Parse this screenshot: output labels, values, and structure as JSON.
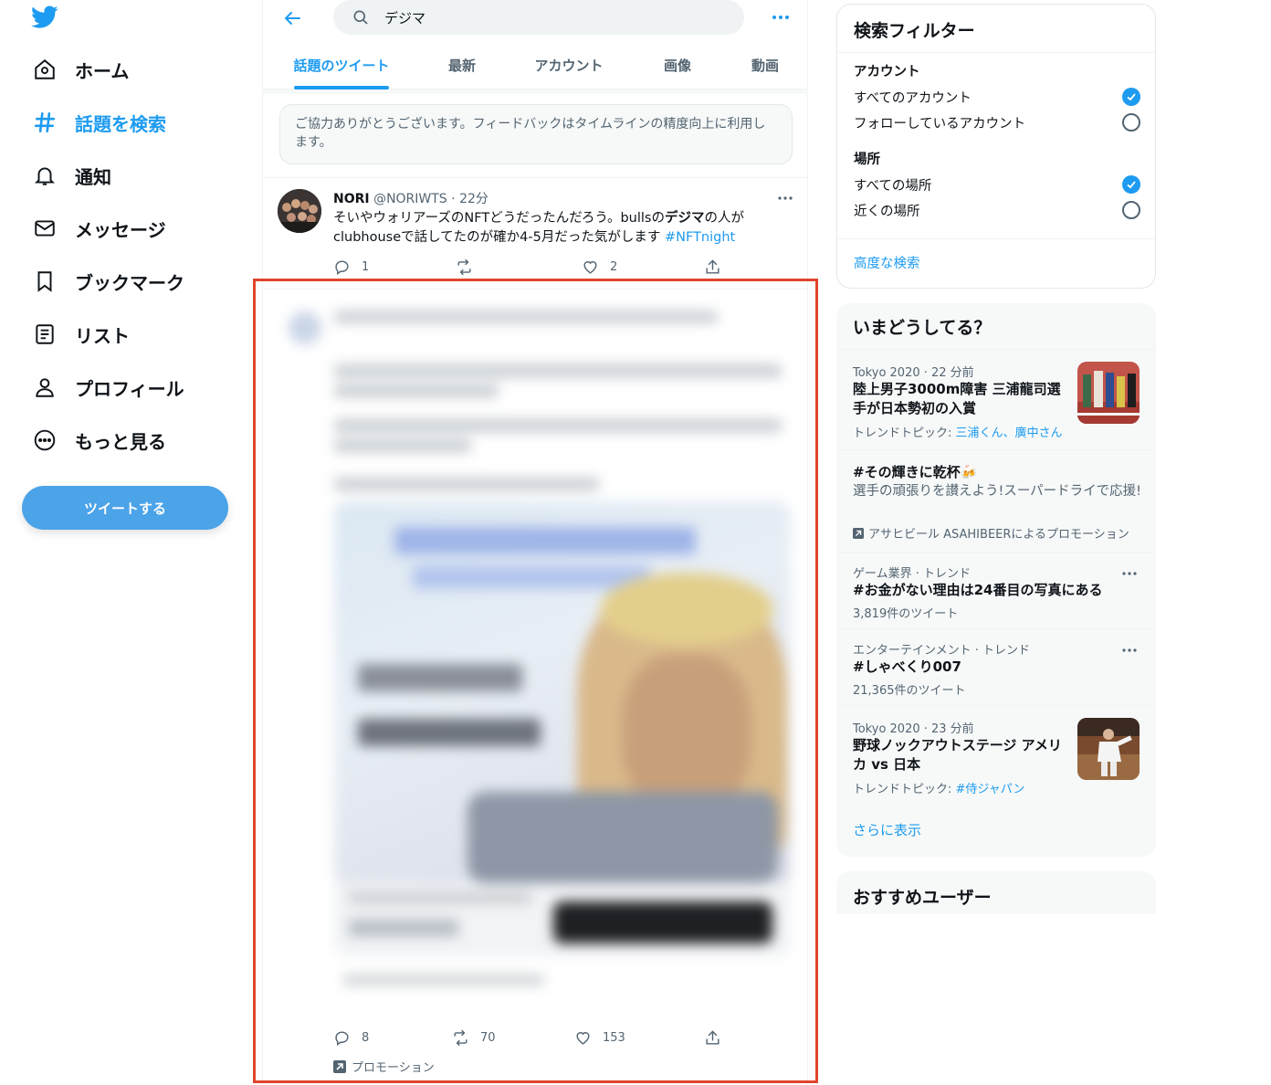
{
  "nav": {
    "items": [
      {
        "label": "ホーム",
        "icon": "home-icon"
      },
      {
        "label": "話題を検索",
        "icon": "hashtag-icon",
        "active": true
      },
      {
        "label": "通知",
        "icon": "bell-icon"
      },
      {
        "label": "メッセージ",
        "icon": "mail-icon"
      },
      {
        "label": "ブックマーク",
        "icon": "bookmark-icon"
      },
      {
        "label": "リスト",
        "icon": "list-icon"
      },
      {
        "label": "プロフィール",
        "icon": "person-icon"
      },
      {
        "label": "もっと見る",
        "icon": "more-circle-icon"
      }
    ],
    "tweet_button": "ツイートする"
  },
  "search": {
    "query": "デジマ"
  },
  "tabs": [
    "話題のツイート",
    "最新",
    "アカウント",
    "画像",
    "動画"
  ],
  "feedback": "ご協力ありがとうございます。フィードバックはタイムラインの精度向上に利用します。",
  "tweet": {
    "name": "NORI",
    "handle": "@NORIWTS",
    "time": "22分",
    "text_1": "そいやウォリアーズのNFTどうだったんだろう。bullsの",
    "text_bold": "デジマ",
    "text_2": "の人が clubhouseで話してたのが確か4-5月だった気がします ",
    "hashtag": "#NFTnight",
    "replies": "1",
    "retweets": "",
    "likes": "2"
  },
  "promo_tweet": {
    "replies": "8",
    "retweets": "70",
    "likes": "153",
    "label": "プロモーション"
  },
  "filter": {
    "title": "検索フィルター",
    "account_heading": "アカウント",
    "account_options": [
      "すべてのアカウント",
      "フォローしているアカウント"
    ],
    "place_heading": "場所",
    "place_options": [
      "すべての場所",
      "近くの場所"
    ],
    "advanced": "高度な検索"
  },
  "trends": {
    "title": "いまどうしてる？",
    "items": [
      {
        "meta": "Tokyo 2020 · 22 分前",
        "title": "陸上男子3000m障害 三浦龍司選手が日本勢初の入賞",
        "sub_prefix": "トレンドトピック: ",
        "sub_links": "三浦くん、廣中さん"
      },
      {
        "title": "#その輝きに乾杯🍻",
        "desc": "選手の頑張りを讃えよう!スーパードライで応援!",
        "promo": "アサヒビール ASAHIBEERによるプロモーション"
      },
      {
        "meta": "ゲーム業界 · トレンド",
        "title": "#お金がない理由は24番目の写真にある",
        "count": "3,819件のツイート"
      },
      {
        "meta": "エンターテインメント · トレンド",
        "title": "#しゃべくり007",
        "count": "21,365件のツイート"
      },
      {
        "meta": "Tokyo 2020 · 23 分前",
        "title": "野球ノックアウトステージ アメリカ vs 日本",
        "sub_prefix": "トレンドトピック: ",
        "sub_links": "#侍ジャパン"
      }
    ],
    "show_more": "さらに表示"
  },
  "suggest": {
    "title": "おすすめユーザー"
  },
  "colors": {
    "accent": "#1d9bf0",
    "highlight_border": "#e0452c"
  }
}
